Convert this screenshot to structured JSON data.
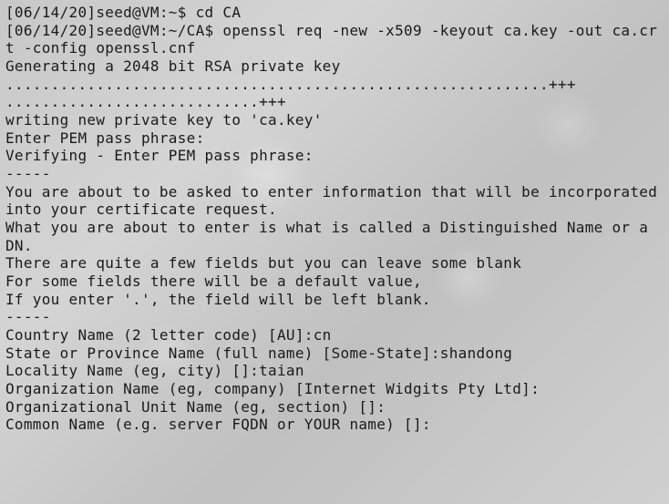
{
  "terminal": {
    "lines": [
      {
        "type": "promptline",
        "prompt": "[06/14/20]seed@VM:~$ ",
        "command": "cd CA"
      },
      {
        "type": "promptline",
        "prompt": "[06/14/20]seed@VM:~/CA$ ",
        "command": "openssl req -new -x509 -keyout ca.key -out ca.crt -config openssl.cnf"
      },
      {
        "type": "output",
        "text": "Generating a 2048 bit RSA private key"
      },
      {
        "type": "output",
        "text": "............................................................+++"
      },
      {
        "type": "output",
        "text": "............................+++"
      },
      {
        "type": "output",
        "text": "writing new private key to 'ca.key'"
      },
      {
        "type": "output",
        "text": "Enter PEM pass phrase:"
      },
      {
        "type": "output",
        "text": "Verifying - Enter PEM pass phrase:"
      },
      {
        "type": "output",
        "text": "-----"
      },
      {
        "type": "output",
        "text": "You are about to be asked to enter information that will be incorporated"
      },
      {
        "type": "output",
        "text": "into your certificate request."
      },
      {
        "type": "output",
        "text": "What you are about to enter is what is called a Distinguished Name or a DN."
      },
      {
        "type": "output",
        "text": "There are quite a few fields but you can leave some blank"
      },
      {
        "type": "output",
        "text": "For some fields there will be a default value,"
      },
      {
        "type": "output",
        "text": "If you enter '.', the field will be left blank."
      },
      {
        "type": "output",
        "text": "-----"
      },
      {
        "type": "output",
        "text": "Country Name (2 letter code) [AU]:cn"
      },
      {
        "type": "output",
        "text": "State or Province Name (full name) [Some-State]:shandong"
      },
      {
        "type": "output",
        "text": "Locality Name (eg, city) []:taian"
      },
      {
        "type": "output",
        "text": "Organization Name (eg, company) [Internet Widgits Pty Ltd]:"
      },
      {
        "type": "output",
        "text": "Organizational Unit Name (eg, section) []:"
      },
      {
        "type": "output",
        "text": "Common Name (e.g. server FQDN or YOUR name) []:"
      }
    ]
  }
}
